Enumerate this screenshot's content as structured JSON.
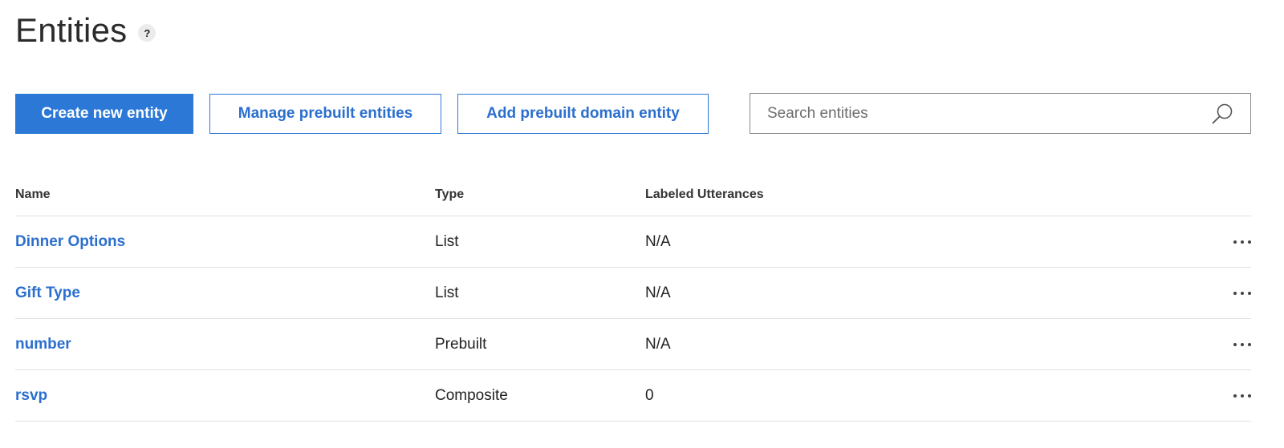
{
  "header": {
    "title": "Entities",
    "help": "?"
  },
  "toolbar": {
    "create_label": "Create new entity",
    "manage_label": "Manage prebuilt entities",
    "add_domain_label": "Add prebuilt domain entity"
  },
  "search": {
    "placeholder": "Search entities",
    "value": ""
  },
  "table": {
    "columns": {
      "name": "Name",
      "type": "Type",
      "labeled": "Labeled Utterances"
    },
    "rows": [
      {
        "name": "Dinner Options",
        "type": "List",
        "labeled": "N/A"
      },
      {
        "name": "Gift Type",
        "type": "List",
        "labeled": "N/A"
      },
      {
        "name": "number",
        "type": "Prebuilt",
        "labeled": "N/A"
      },
      {
        "name": "rsvp",
        "type": "Composite",
        "labeled": "0"
      }
    ]
  },
  "icons": {
    "search": "search-icon",
    "row_more": "more-options-icon"
  },
  "colors": {
    "accent": "#2b78d6",
    "link": "#2b6fce",
    "divider": "#e1e1e1"
  }
}
